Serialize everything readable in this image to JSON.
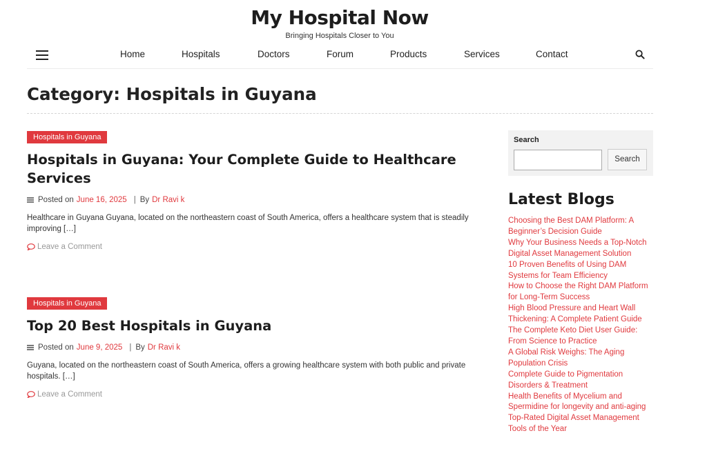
{
  "site": {
    "title": "My Hospital Now",
    "tagline": "Bringing Hospitals Closer to You"
  },
  "nav": {
    "items": [
      "Home",
      "Hospitals",
      "Doctors",
      "Forum",
      "Products",
      "Services",
      "Contact"
    ]
  },
  "category_title": "Category: Hospitals in Guyana",
  "posts": [
    {
      "tag": "Hospitals in Guyana",
      "title": "Hospitals in Guyana: Your Complete Guide to Healthcare Services",
      "posted_on": "Posted on",
      "date": "June 16, 2025",
      "separator": "|",
      "by": "By",
      "author": "Dr Ravi k",
      "excerpt": "Healthcare in Guyana Guyana, located on the northeastern coast of South America, offers a healthcare system that is steadily improving […]",
      "comment": "Leave a Comment"
    },
    {
      "tag": "Hospitals in Guyana",
      "title": "Top 20 Best Hospitals in Guyana",
      "posted_on": "Posted on",
      "date": "June 9, 2025",
      "separator": "|",
      "by": "By",
      "author": "Dr Ravi k",
      "excerpt": "Guyana, located on the northeastern coast of South America, offers a growing healthcare system with both public and private hospitals. […]",
      "comment": "Leave a Comment"
    }
  ],
  "sidebar": {
    "search_label": "Search",
    "search_value": "",
    "search_button": "Search",
    "latest_title": "Latest Blogs",
    "latest": [
      "Choosing the Best DAM Platform: A Beginner’s Decision Guide",
      "Why Your Business Needs a Top-Notch Digital Asset Management Solution",
      "10 Proven Benefits of Using DAM Systems for Team Efficiency",
      "How to Choose the Right DAM Platform for Long-Term Success",
      "High Blood Pressure and Heart Wall Thickening: A Complete Patient Guide",
      "The Complete Keto Diet User Guide: From Science to Practice",
      "A Global Risk Weighs: The Aging Population Crisis",
      "Complete Guide to Pigmentation Disorders & Treatment",
      "Health Benefits of Mycelium and Spermidine for longevity and anti-aging",
      "Top-Rated Digital Asset Management Tools of the Year"
    ]
  },
  "colors": {
    "accent": "#e0393e",
    "text": "#222222",
    "muted": "#999999"
  },
  "icons": {
    "menu": "hamburger-menu-icon",
    "search": "search-icon",
    "meta": "list-lines-icon",
    "comment": "speech-bubble-icon"
  }
}
